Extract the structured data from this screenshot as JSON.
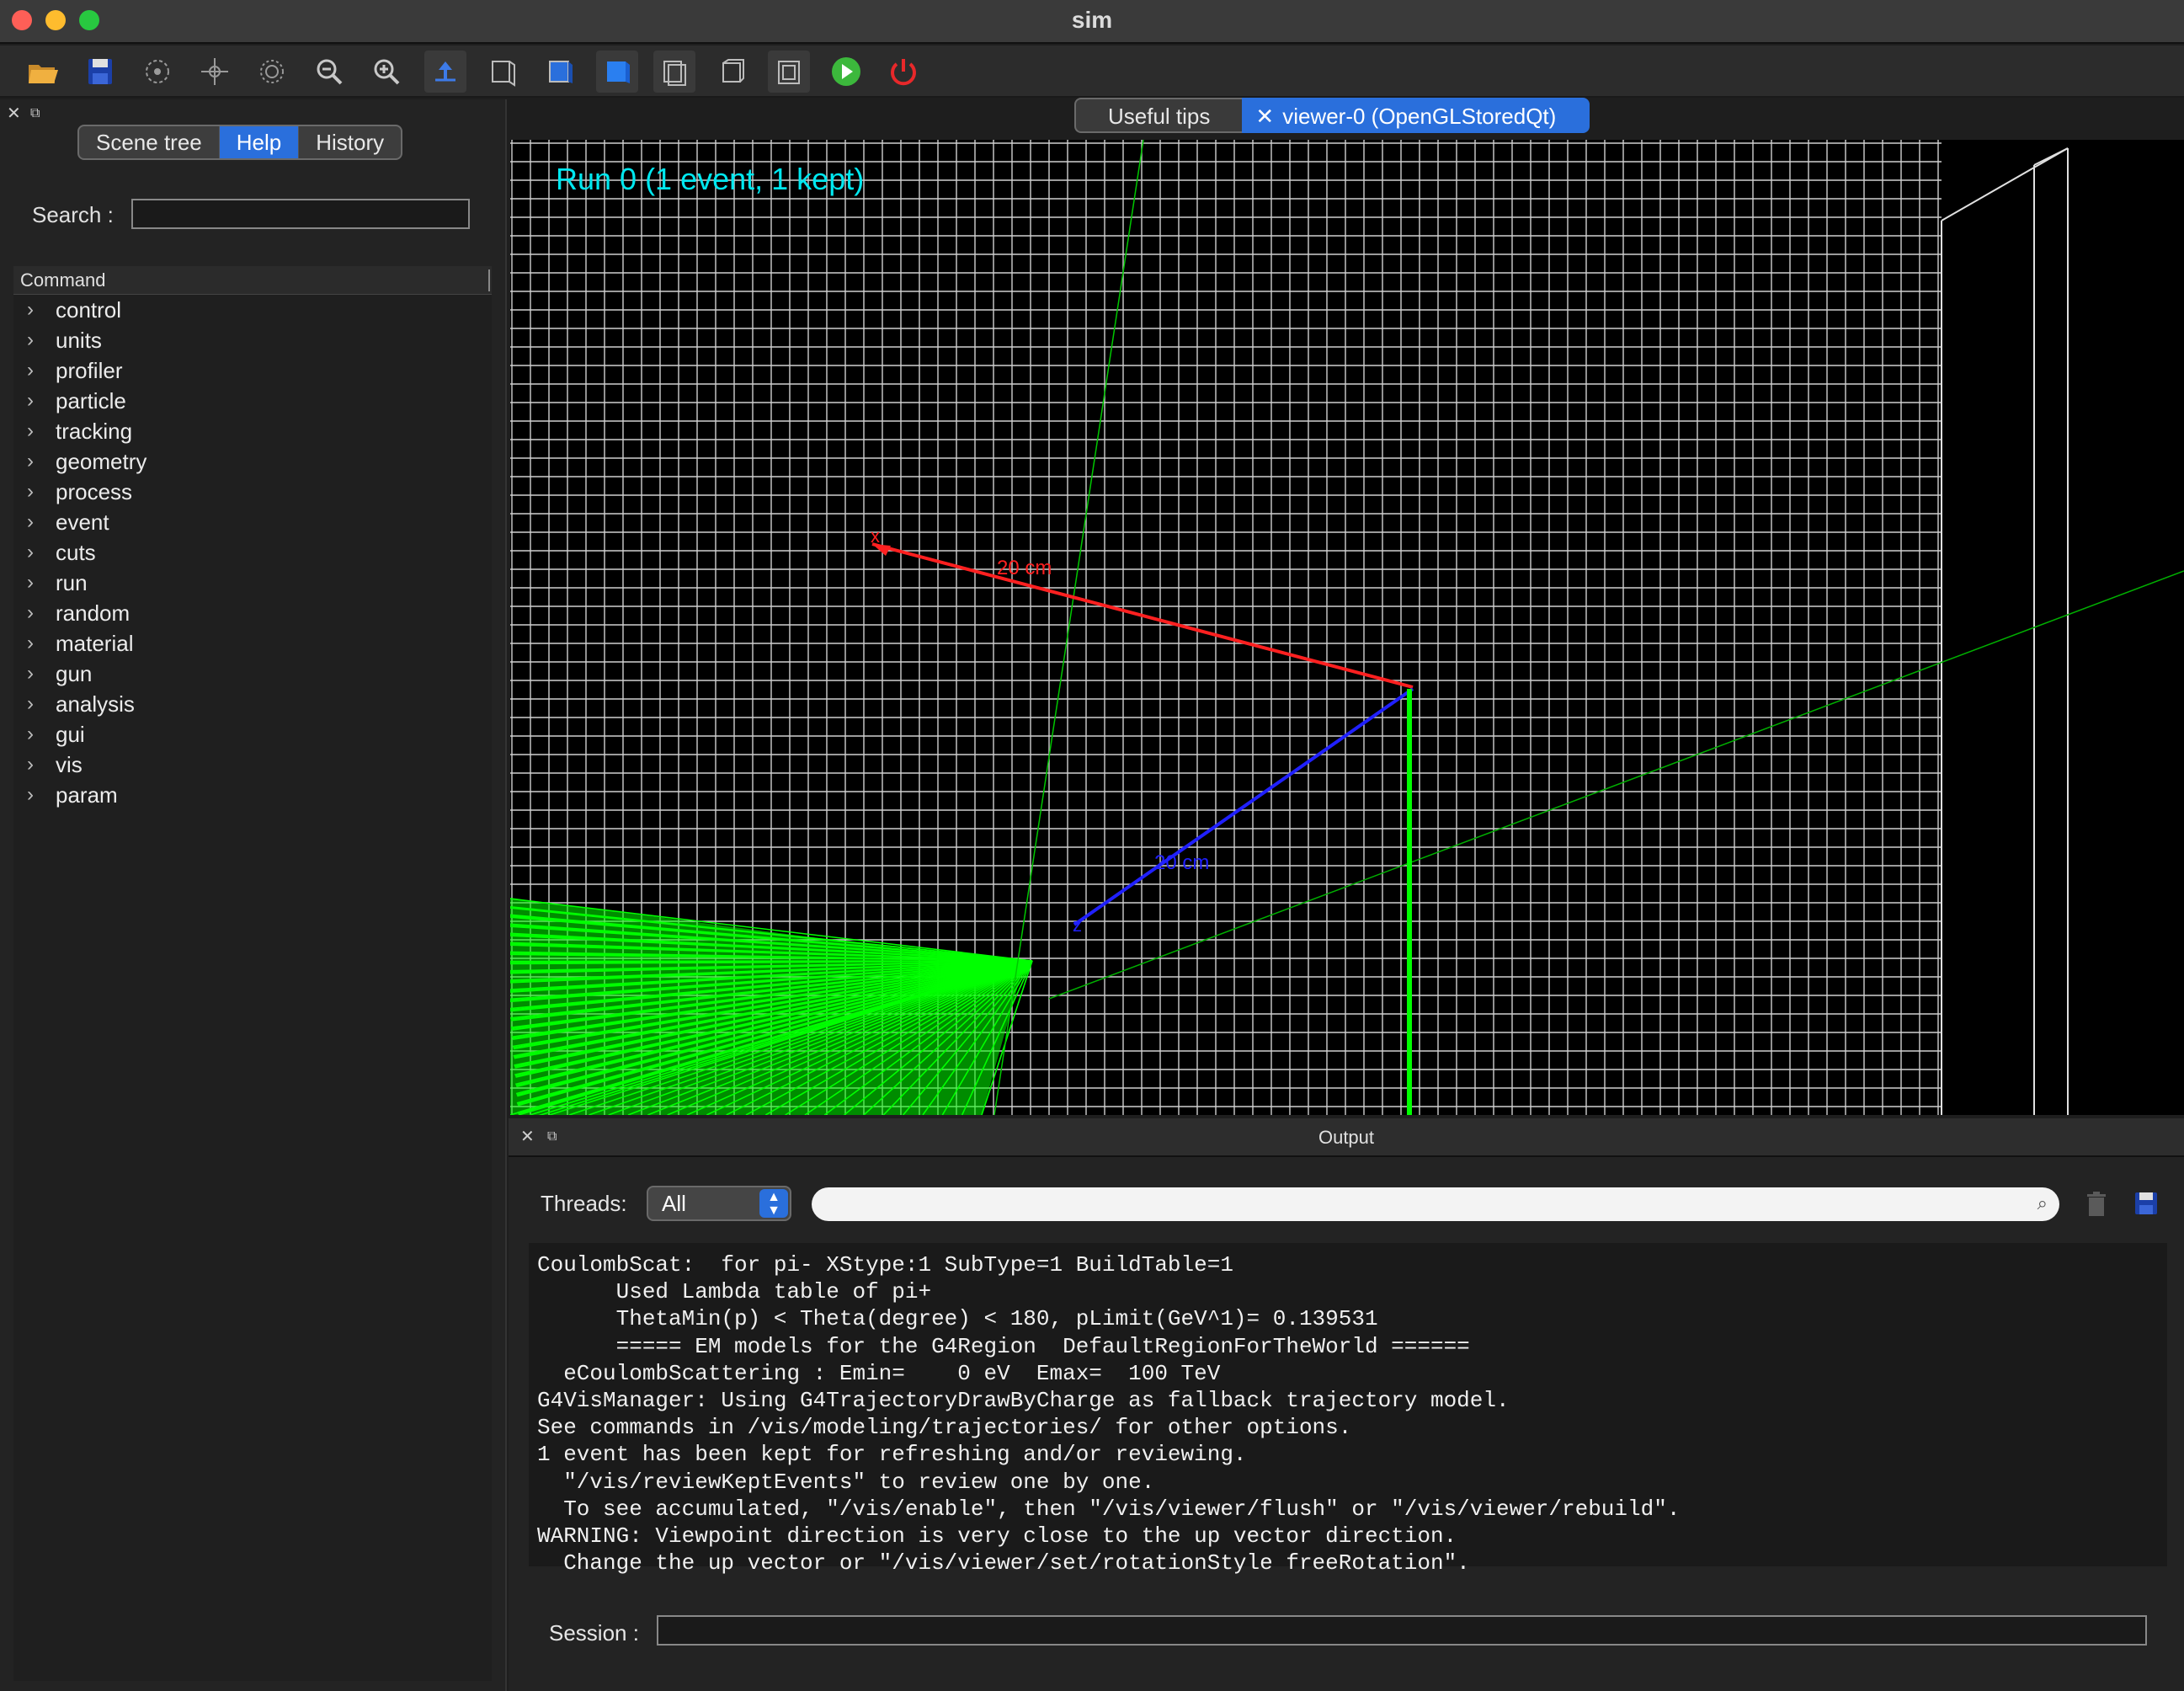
{
  "window": {
    "title": "sim"
  },
  "toolbar": {
    "icons": [
      "open-folder-icon",
      "save-icon",
      "rotate-icon",
      "move-icon",
      "pick-icon",
      "zoom-out-icon",
      "zoom-in-icon",
      "perspective-icon",
      "wireframe-icon",
      "solid-icon",
      "surface-icon",
      "hidden-line-icon",
      "hidden-line-removal-icon",
      "hidden-surface-icon",
      "run-beam-icon",
      "stop-icon"
    ]
  },
  "left_dock": {
    "tabs": [
      "Scene tree",
      "Help",
      "History"
    ],
    "active_tab": "Help",
    "search_label": "Search :",
    "search_value": "",
    "column_header": "Command",
    "commands": [
      "control",
      "units",
      "profiler",
      "particle",
      "tracking",
      "geometry",
      "process",
      "event",
      "cuts",
      "run",
      "random",
      "material",
      "gun",
      "analysis",
      "gui",
      "vis",
      "param"
    ]
  },
  "viewer_tabs": {
    "tips": "Useful tips",
    "viewer": "viewer-0 (OpenGLStoredQt)"
  },
  "viewer": {
    "run_label": "Run 0 (1 event, 1 kept)",
    "axis_x_label": "20 cm",
    "axis_z_label": "20 cm"
  },
  "output": {
    "title": "Output",
    "threads_label": "Threads:",
    "threads_value": "All",
    "filter_value": "",
    "lines": [
      "CoulombScat:  for pi- XStype:1 SubType=1 BuildTable=1",
      "      Used Lambda table of pi+",
      "      ThetaMin(p) < Theta(degree) < 180, pLimit(GeV^1)= 0.139531",
      "      ===== EM models for the G4Region  DefaultRegionForTheWorld ======",
      "  eCoulombScattering : Emin=    0 eV  Emax=  100 TeV",
      "G4VisManager: Using G4TrajectoryDrawByCharge as fallback trajectory model.",
      "See commands in /vis/modeling/trajectories/ for other options.",
      "1 event has been kept for refreshing and/or reviewing.",
      "  \"/vis/reviewKeptEvents\" to review one by one.",
      "  To see accumulated, \"/vis/enable\", then \"/vis/viewer/flush\" or \"/vis/viewer/rebuild\".",
      "WARNING: Viewpoint direction is very close to the up vector direction.",
      "  Change the up vector or \"/vis/viewer/set/rotationStyle freeRotation\"."
    ],
    "session_label": "Session :",
    "session_value": ""
  },
  "colors": {
    "accent": "#2a6fdc",
    "run_label": "#00e8f0",
    "trajectories": "#00ff00",
    "axis_x": "#ff2020",
    "axis_y": "#00ff00",
    "axis_z": "#2020ff"
  }
}
